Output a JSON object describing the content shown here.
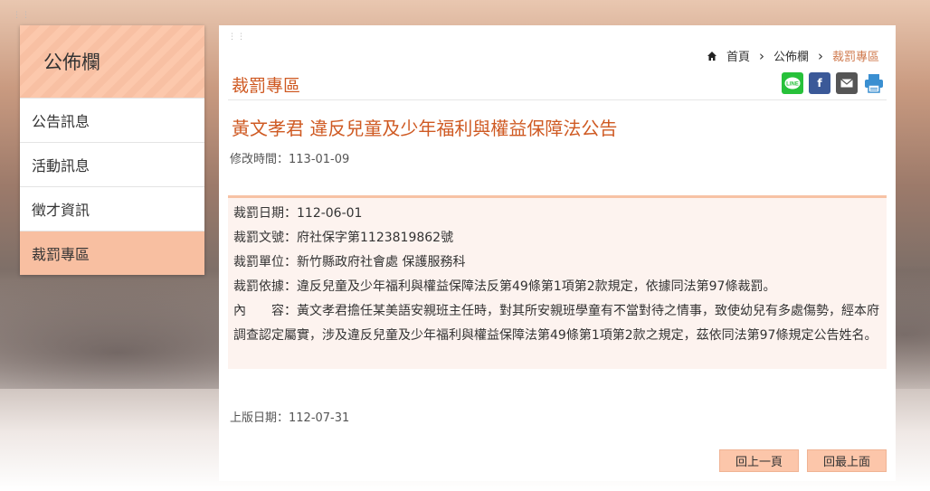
{
  "sidebar": {
    "title": "公佈欄",
    "items": [
      {
        "label": "公告訊息"
      },
      {
        "label": "活動訊息"
      },
      {
        "label": "徵才資訊"
      },
      {
        "label": "裁罰專區",
        "active": true
      }
    ]
  },
  "breadcrumb": {
    "home": "首頁",
    "level1": "公佈欄",
    "current": "裁罰專區"
  },
  "section_title": "裁罰專區",
  "share": {
    "line_label": "LINE",
    "facebook_label": "f"
  },
  "article": {
    "title": "黃文孝君 違反兒童及少年福利與權益保障法公告",
    "modified": "修改時間：113-01-09",
    "penalty_date": "裁罰日期：112-06-01",
    "doc_no": "裁罰文號：府社保字第1123819862號",
    "unit": "裁罰單位：新竹縣政府社會處 保護服務科",
    "basis": "裁罰依據：違反兒童及少年福利與權益保障法反第49條第1項第2款規定，依據同法第97條裁罰。",
    "content_label": "內　　容：",
    "content_text": "黃文孝君擔任某美語安親班主任時，對其所安親班學童有不當對待之情事，致使幼兒有多處傷勢，經本府調查認定屬實，涉及違反兒童及少年福利與權益保障法第49條第1項第2款之規定，茲依同法第97條規定公告姓名。",
    "published": "上版日期：112-07-31"
  },
  "buttons": {
    "back": "回上一頁",
    "top": "回最上面"
  },
  "colors": {
    "accent": "#cf5a23",
    "sidebar_highlight": "#f8bfa1"
  }
}
